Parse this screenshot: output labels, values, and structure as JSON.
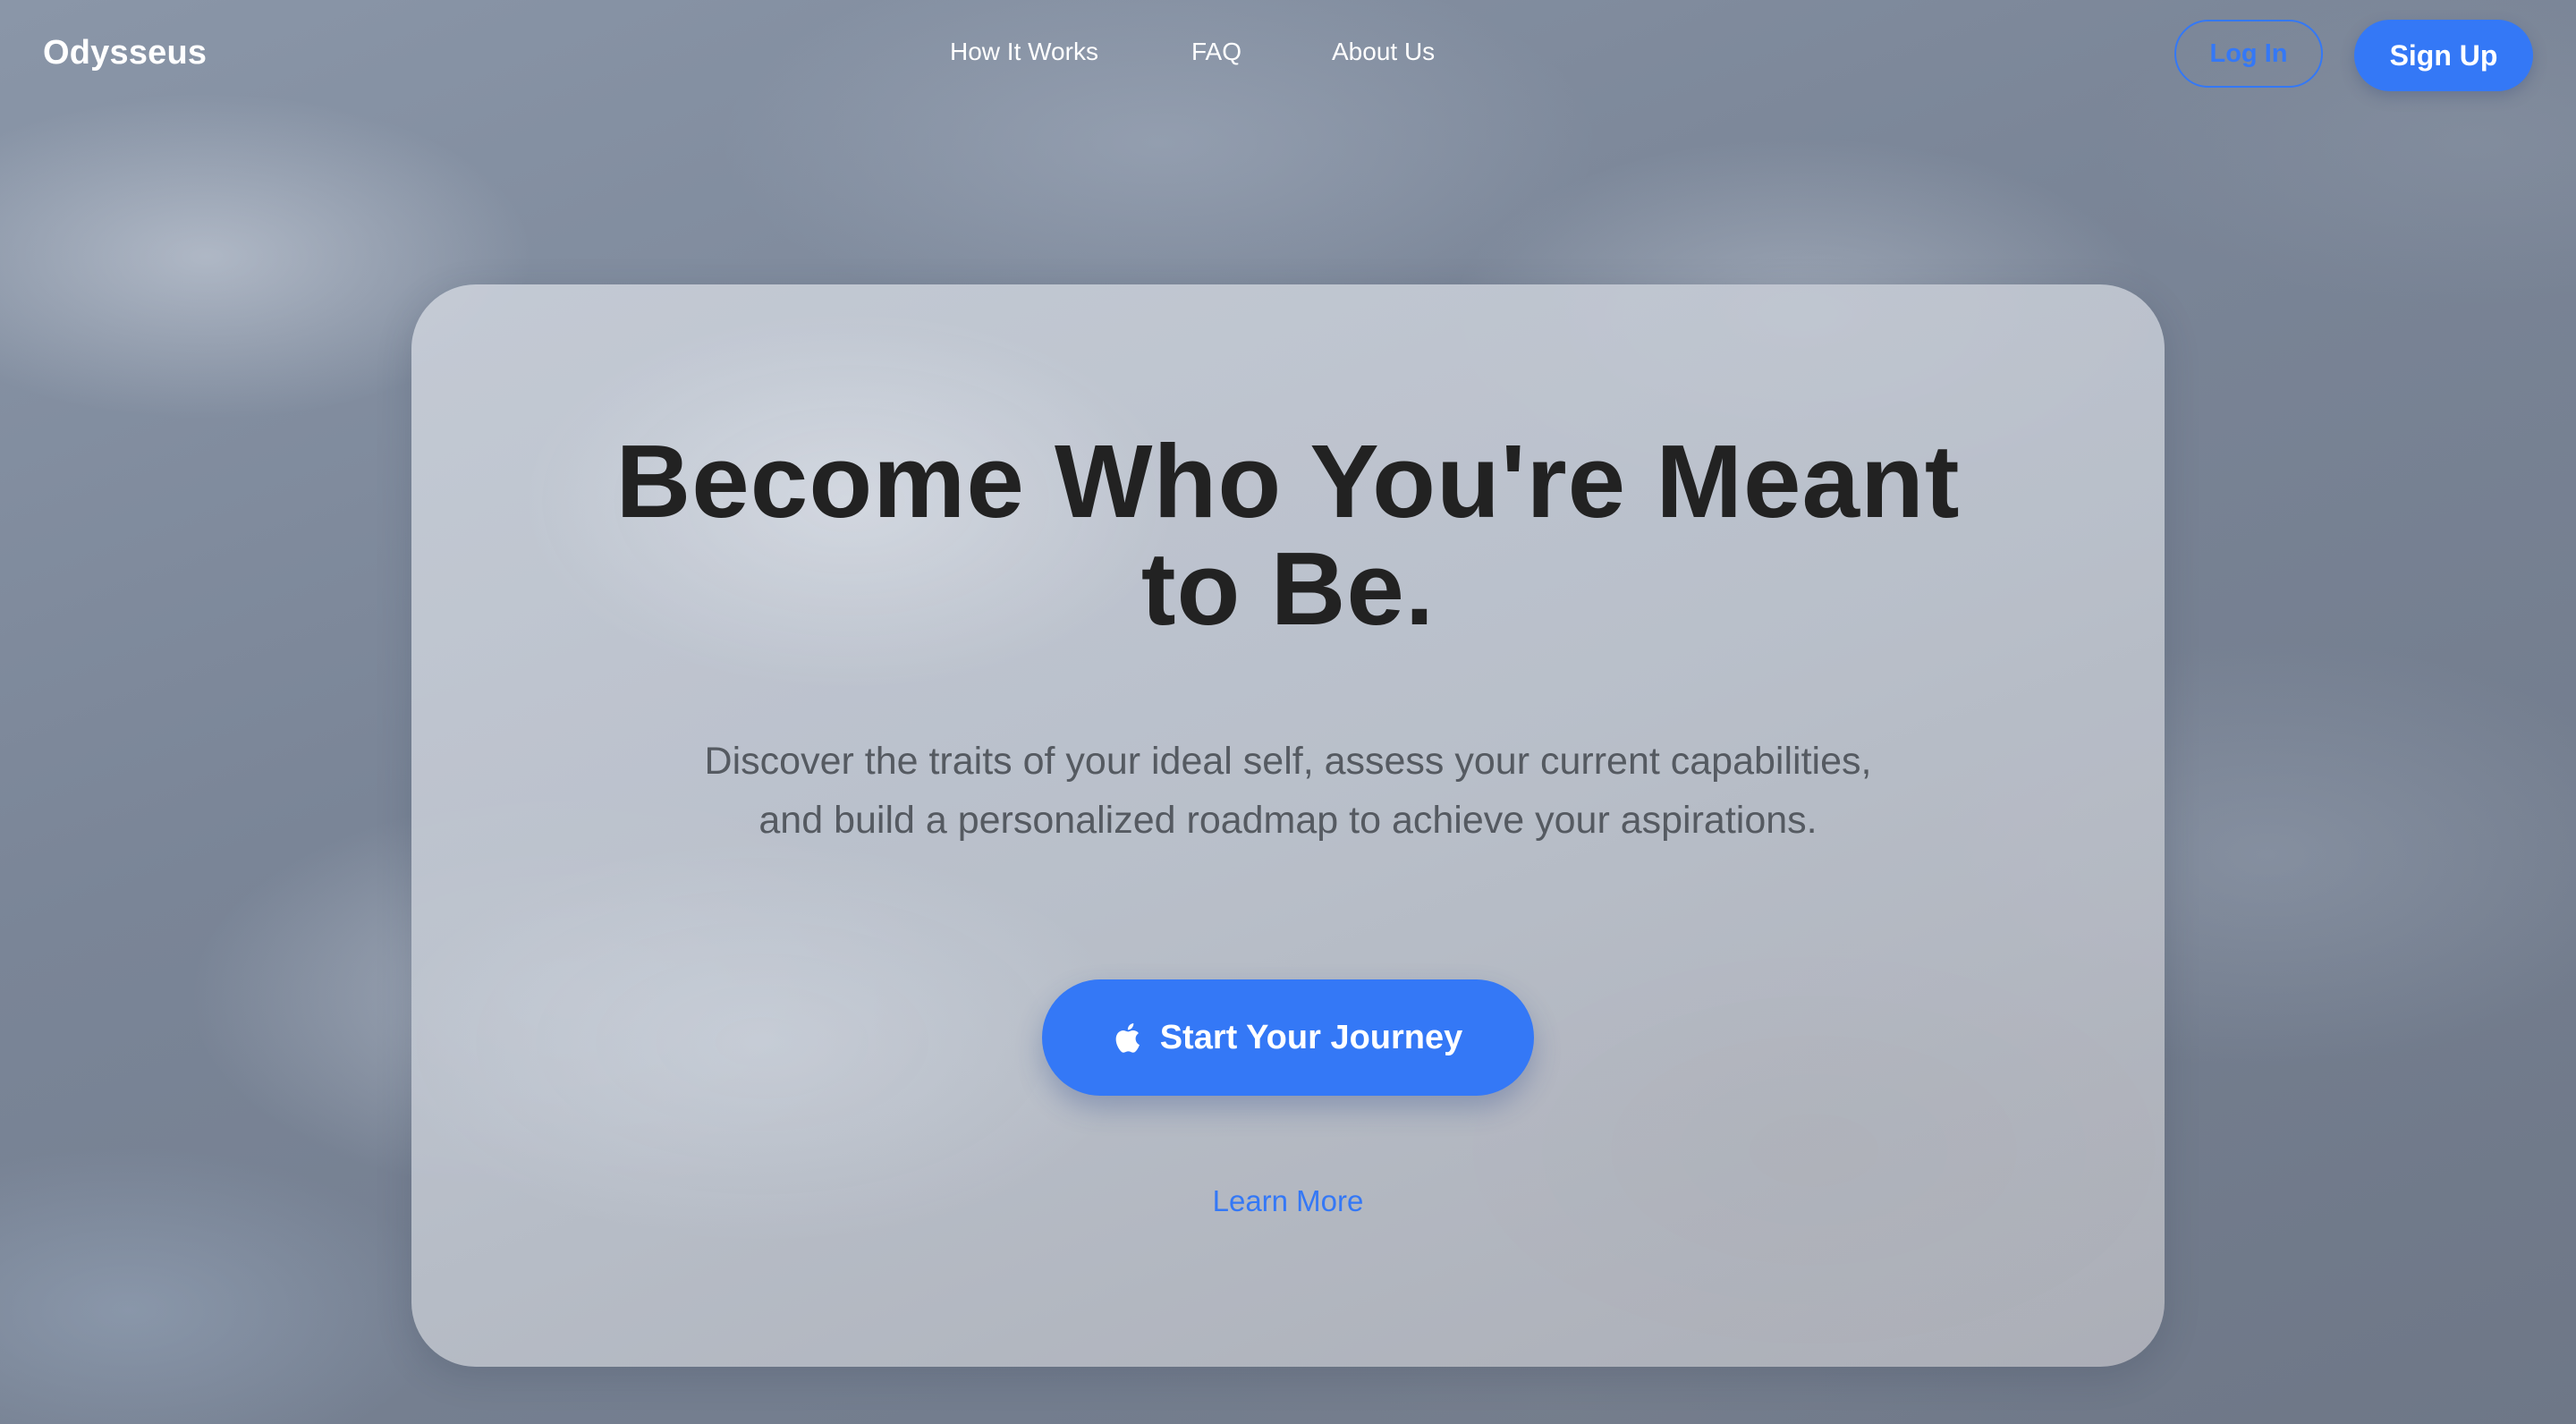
{
  "nav": {
    "brand": "Odysseus",
    "links": [
      "How It Works",
      "FAQ",
      "About Us"
    ],
    "login_label": "Log In",
    "signup_label": "Sign Up"
  },
  "hero": {
    "headline_lines": [
      "Become Who You're Meant",
      "to Be."
    ],
    "subtext_lines": [
      "Discover the traits of your ideal self, assess your current capabilities,",
      "and build a personalized roadmap to achieve your aspirations."
    ],
    "cta_label": "Start Your Journey",
    "cta_icon": "apple-icon",
    "learn_more_label": "Learn More"
  },
  "colors": {
    "accent": "#3478f6",
    "headline": "#222222",
    "subtext": "#555a61"
  }
}
